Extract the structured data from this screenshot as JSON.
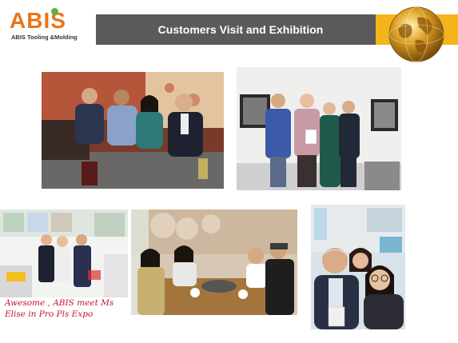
{
  "slide": {
    "title": "Customers Visit and Exhibition",
    "logo": {
      "word": "ABIS",
      "subtitle": "ABIS Tooling &Molding"
    },
    "colors": {
      "title_bar": "#5a5a5a",
      "accent": "#f3b51b",
      "logo": "#e8751a",
      "caption": "#c8102e"
    },
    "globe_icon": "gold-globe-icon",
    "photos": [
      {
        "name": "photo-restaurant-group"
      },
      {
        "name": "photo-office-group"
      },
      {
        "name": "photo-exhibition-booth"
      },
      {
        "name": "photo-dinner-table"
      },
      {
        "name": "photo-selfie-expo"
      }
    ],
    "caption": {
      "line1": "Awesome , ABIS meet Ms",
      "line2": "Elise in Pro Pls Expo"
    }
  }
}
